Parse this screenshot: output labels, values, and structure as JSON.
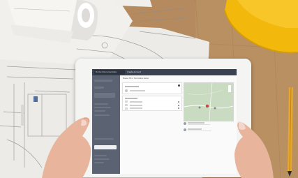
{
  "scene": {
    "type": "photo",
    "subject": "hands holding a tablet over architectural blueprints on a wooden desk",
    "objects": [
      "rolled-blueprints",
      "blueprint-sheets",
      "tablet",
      "left-hand",
      "right-hand",
      "yellow-hard-hat",
      "pencil",
      "wooden-desk"
    ]
  },
  "blueprint": {
    "label": "2"
  },
  "tablet_app": {
    "brand": "Product Documentation",
    "title": "Create Account",
    "heading": "Please fill in the details below",
    "colors": {
      "topbar": "#3a4251",
      "sidebar": "#5b6372",
      "map": "#c9dcc1",
      "pin": "#d04040"
    }
  }
}
